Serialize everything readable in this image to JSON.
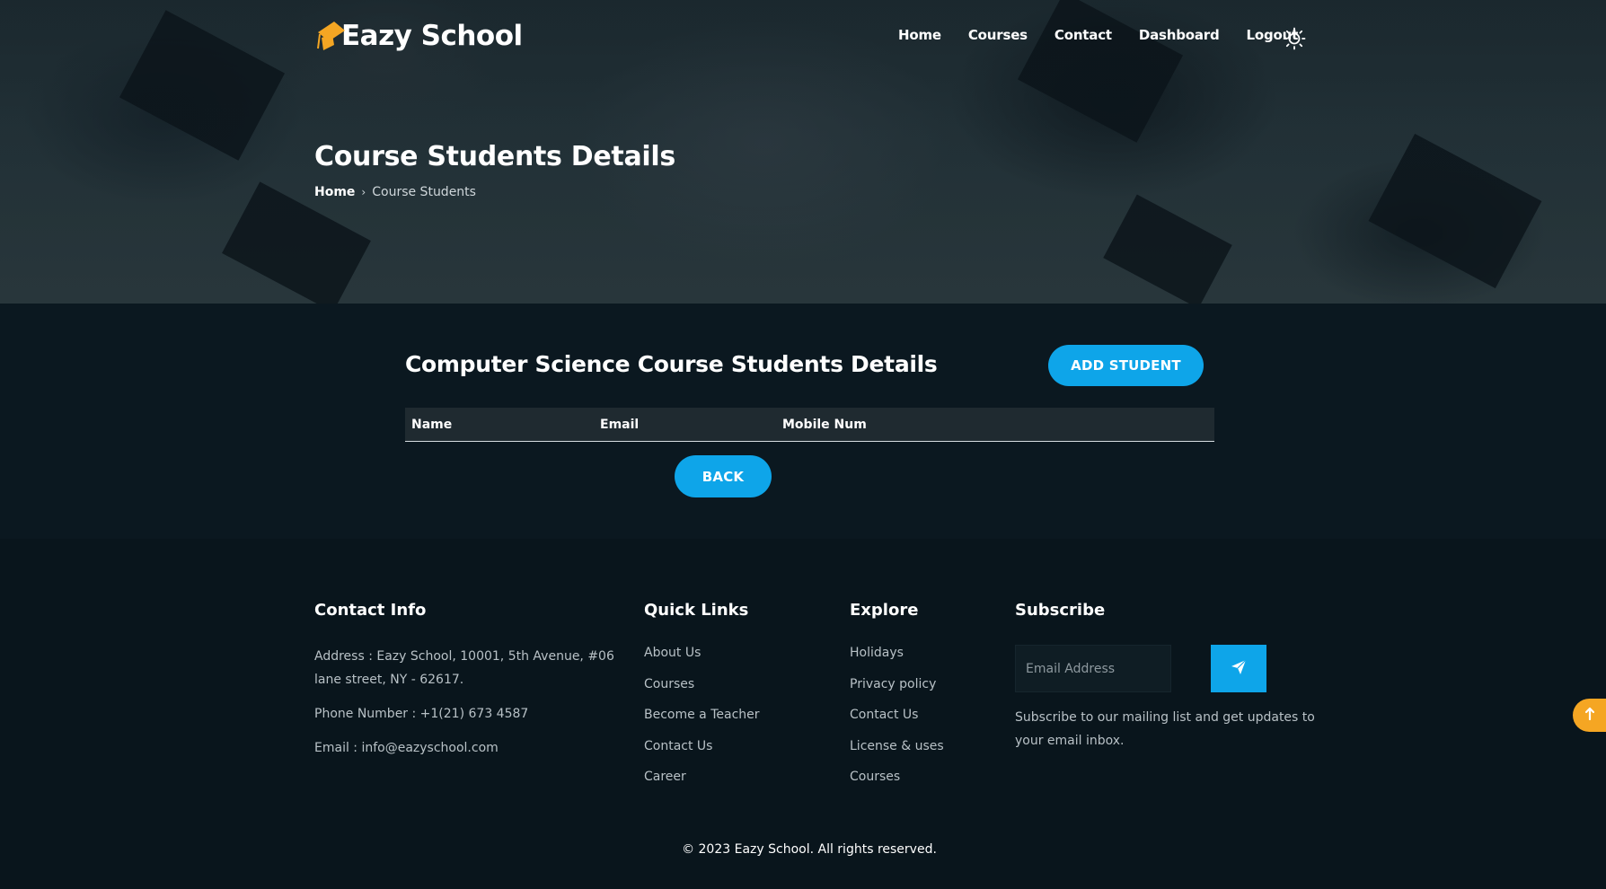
{
  "brand": {
    "name": "Eazy School",
    "accent": "#0ea5e9",
    "logo_color": "#f5a623"
  },
  "nav": {
    "items": [
      "Home",
      "Courses",
      "Contact",
      "Dashboard",
      "Logout"
    ],
    "theme_icon": "sun-icon"
  },
  "hero": {
    "title": "Course Students Details",
    "breadcrumb": {
      "home": "Home",
      "separator": "›",
      "current": "Course Students"
    }
  },
  "main": {
    "title": "Computer Science Course Students Details",
    "add_button": "ADD STUDENT",
    "back_button": "BACK",
    "table": {
      "columns": [
        "Name",
        "Email",
        "Mobile Num"
      ],
      "rows": []
    }
  },
  "footer": {
    "contact": {
      "title": "Contact Info",
      "address_line1": "Address : Eazy School, 10001, 5th Avenue, #06",
      "address_line2": "lane street, NY - 62617.",
      "phone": "Phone Number : +1(21) 673 4587",
      "email": "Email : info@eazyschool.com"
    },
    "quick_links": {
      "title": "Quick Links",
      "items": [
        "About Us",
        "Courses",
        "Become a Teacher",
        "Contact Us",
        "Career"
      ]
    },
    "explore": {
      "title": "Explore",
      "items": [
        "Holidays",
        "Privacy policy",
        "Contact Us",
        "License & uses",
        "Courses"
      ]
    },
    "subscribe": {
      "title": "Subscribe",
      "placeholder": "Email Address",
      "button_icon": "send-icon",
      "text_line1": "Subscribe to our mailing list and get updates to",
      "text_line2": "your email inbox."
    },
    "copyright": "© 2023 Eazy School. All rights reserved."
  },
  "scroll_top": {
    "icon": "arrow-up-icon",
    "color": "#f5a623"
  }
}
